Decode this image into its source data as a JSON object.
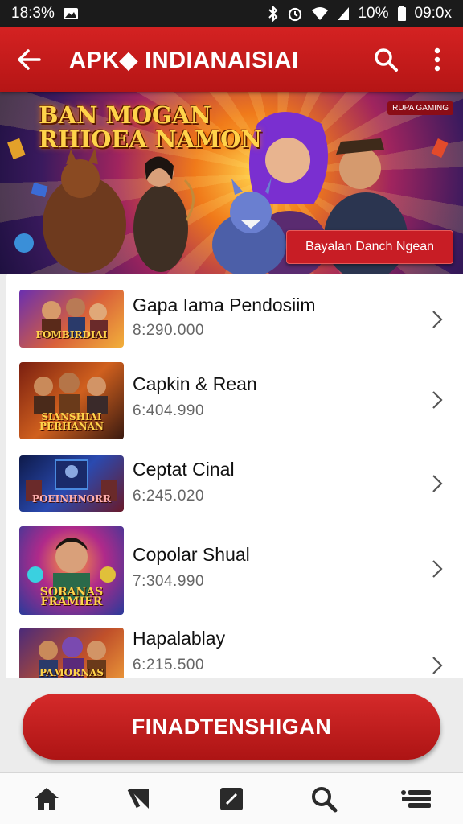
{
  "status_bar": {
    "left_time": "18:3%",
    "battery_percent": "10%",
    "clock": "09:0x",
    "icons": [
      "image-icon",
      "bluetooth-icon",
      "alarm-icon",
      "wifi-icon",
      "signal-icon",
      "battery-icon"
    ]
  },
  "app_bar": {
    "title": "APK◆ INDIANAISIAI",
    "icons": [
      "back-arrow-icon",
      "search-icon",
      "more-vert-icon"
    ]
  },
  "banner": {
    "headline_line1": "BAN MOGAN",
    "headline_line2": "RHIOEA NAMON",
    "chip": "RUPA GAMING",
    "cta_label": "Bayalan Danch Ngean"
  },
  "list": {
    "items": [
      {
        "title": "Gapa Iama Pendosiim",
        "subtitle": "8:290.000",
        "thumb_label": "FOMBIRDIAI"
      },
      {
        "title": "Capkin & Rean",
        "subtitle": "6:404.990",
        "thumb_label": "SIANSHIAI PERHANAN"
      },
      {
        "title": "Ceptat Cinal",
        "subtitle": "6:245.020",
        "thumb_label": "POEINHNORR"
      },
      {
        "title": "Copolar Shual",
        "subtitle": "7:304.990",
        "thumb_label": "SORANAS FRAMIER"
      },
      {
        "title": "Hapalablay",
        "subtitle": "6:215.500",
        "thumb_label": "PAMORNAS"
      }
    ]
  },
  "primary_button": {
    "label": "FINADTENSHIGAN"
  },
  "bottom_nav": {
    "items": [
      "home-icon",
      "back-triangle-icon",
      "edit-icon",
      "search-icon",
      "menu-icon"
    ]
  },
  "colors": {
    "brand_red": "#c41c1c",
    "status_bar_bg": "#1b1b1b",
    "banner_gold": "#ffd34a"
  }
}
